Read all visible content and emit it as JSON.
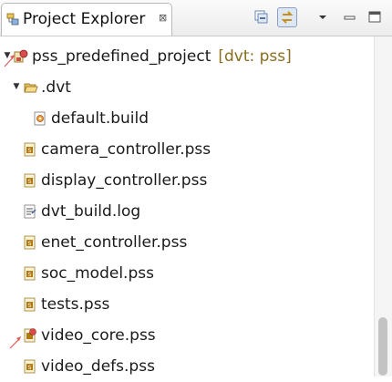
{
  "view": {
    "title": "Project Explorer",
    "close_glyph": "⊠",
    "icon": "project-explorer-icon"
  },
  "toolbar": {
    "collapse_all_icon": "collapse-all-icon",
    "link_editor_icon": "link-with-editor-icon",
    "view_menu_icon": "view-menu-icon",
    "minimize_icon": "minimize-icon",
    "maximize_icon": "maximize-icon"
  },
  "tree": {
    "project": {
      "name": "pss_predefined_project",
      "decoration": "[dvt: pss]",
      "expanded": true
    },
    "items": [
      {
        "label": ".dvt",
        "type": "folder",
        "expanded": true
      },
      {
        "label": "default.build",
        "type": "build"
      },
      {
        "label": "camera_controller.pss",
        "type": "pss"
      },
      {
        "label": "display_controller.pss",
        "type": "pss"
      },
      {
        "label": "dvt_build.log",
        "type": "log"
      },
      {
        "label": "enet_controller.pss",
        "type": "pss"
      },
      {
        "label": "soc_model.pss",
        "type": "pss"
      },
      {
        "label": "tests.pss",
        "type": "pss"
      },
      {
        "label": "video_core.pss",
        "type": "pss-error"
      },
      {
        "label": "video_defs.pss",
        "type": "pss"
      }
    ]
  },
  "colors": {
    "annotation_arrow": "#e05a5a",
    "decoration_text": "#8a6d1f",
    "pss_icon": "#b07a10"
  }
}
